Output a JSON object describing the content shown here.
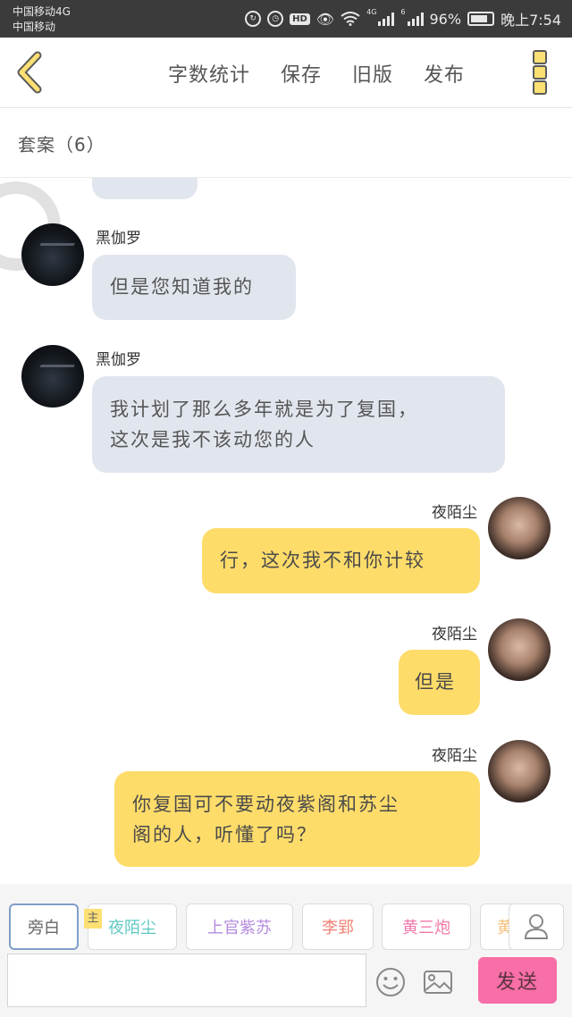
{
  "status_bar": {
    "carrier1": "中国移动4G",
    "carrier2": "中国移动",
    "network1": "4G",
    "network2": "6",
    "battery_percent": "96%",
    "time": "晚上7:54"
  },
  "toolbar": {
    "word_count": "字数统计",
    "save": "保存",
    "old_version": "旧版",
    "publish": "发布"
  },
  "section": {
    "title": "套案（6）"
  },
  "messages": [
    {
      "sender": "黑伽罗",
      "side": "left",
      "lines": [
        "但是您知道我的"
      ]
    },
    {
      "sender": "黑伽罗",
      "side": "left",
      "lines": [
        "我计划了那么多年就是为了复国，",
        "这次是我不该动您的人"
      ]
    },
    {
      "sender": "夜陌尘",
      "side": "right",
      "lines": [
        "行，这次我不和你计较"
      ]
    },
    {
      "sender": "夜陌尘",
      "side": "right",
      "lines": [
        "但是"
      ]
    },
    {
      "sender": "夜陌尘",
      "side": "right",
      "lines": [
        "你复国可不要动夜紫阁和苏尘",
        "阁的人，听懂了吗？"
      ]
    }
  ],
  "roles": {
    "main_tag": "主",
    "items": [
      {
        "label": "旁白",
        "color": "#666666"
      },
      {
        "label": "夜陌尘",
        "color": "#5fc9c4"
      },
      {
        "label": "上官紫苏",
        "color": "#b58be0"
      },
      {
        "label": "李郢",
        "color": "#f07f72"
      },
      {
        "label": "黄三炮",
        "color": "#f079a9"
      },
      {
        "label": "黄",
        "color": "#f4c07a"
      }
    ]
  },
  "composer": {
    "input_value": "",
    "send": "发送"
  },
  "colors": {
    "left_bubble": "#e1e6ee",
    "right_bubble": "#fedc6a",
    "send_button": "#f86ea6",
    "accent_yellow": "#fde073"
  }
}
